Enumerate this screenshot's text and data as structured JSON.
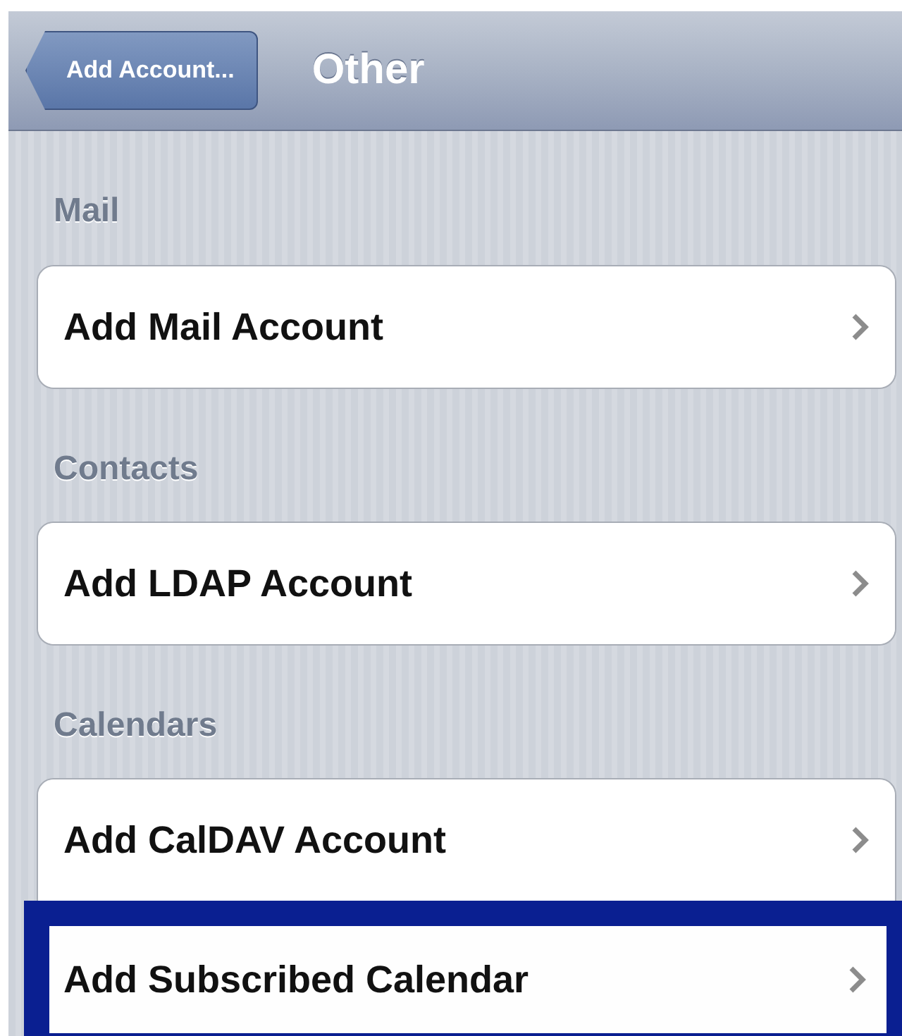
{
  "nav_bar": {
    "back_button": "Add Account...",
    "title": "Other"
  },
  "sections": [
    {
      "header": "Mail",
      "rows": [
        {
          "label": "Add Mail Account",
          "highlighted": false
        }
      ]
    },
    {
      "header": "Contacts",
      "rows": [
        {
          "label": "Add LDAP Account",
          "highlighted": false
        }
      ]
    },
    {
      "header": "Calendars",
      "rows": [
        {
          "label": "Add CalDAV Account",
          "highlighted": false
        },
        {
          "label": "Add Subscribed Calendar",
          "highlighted": true
        }
      ]
    }
  ]
}
